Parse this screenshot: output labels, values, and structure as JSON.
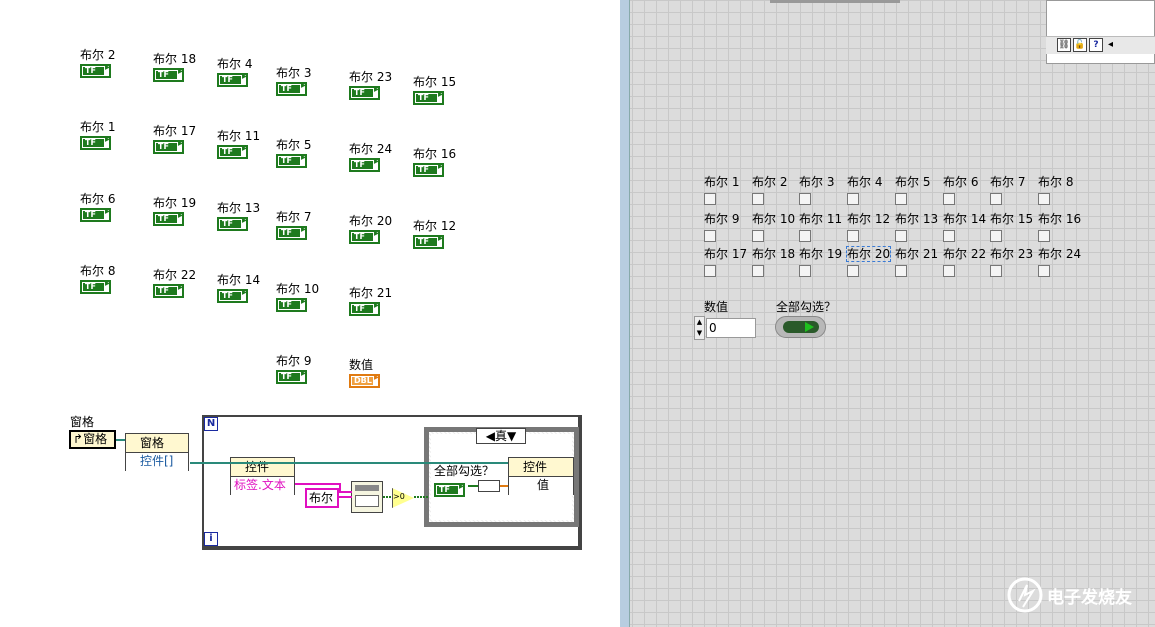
{
  "block_diagram": {
    "terminals": [
      {
        "label": "布尔 2"
      },
      {
        "label": "布尔 18"
      },
      {
        "label": "布尔 4"
      },
      {
        "label": "布尔 3"
      },
      {
        "label": "布尔 23"
      },
      {
        "label": "布尔 15"
      },
      {
        "label": "布尔 1"
      },
      {
        "label": "布尔 17"
      },
      {
        "label": "布尔 11"
      },
      {
        "label": "布尔 5"
      },
      {
        "label": "布尔 24"
      },
      {
        "label": "布尔 16"
      },
      {
        "label": "布尔 6"
      },
      {
        "label": "布尔 19"
      },
      {
        "label": "布尔 13"
      },
      {
        "label": "布尔 7"
      },
      {
        "label": "布尔 20"
      },
      {
        "label": "布尔 12"
      },
      {
        "label": "布尔 8"
      },
      {
        "label": "布尔 22"
      },
      {
        "label": "布尔 14"
      },
      {
        "label": "布尔 10"
      },
      {
        "label": "布尔 21"
      },
      {
        "label": "布尔 9"
      }
    ],
    "tf_badge": "TF",
    "numeric_terminal": {
      "label": "数值",
      "badge": "DBL"
    },
    "pane": {
      "label": "窗格",
      "ref_text": "窗格"
    },
    "property_node": {
      "class_text": "窗格",
      "property": "控件[]"
    },
    "for_loop": {
      "n_label": "N",
      "i_label": "i"
    },
    "inner_node": {
      "class_text": "控件",
      "property": "标签.文本"
    },
    "string_const": "布尔",
    "case": {
      "selector": "真"
    },
    "case_terminal_label": "全部勾选？",
    "case_badge": "TF",
    "case_prop_node": {
      "class_text": "控件",
      "property": "值"
    },
    "compare": ">0"
  },
  "front_panel": {
    "checkboxes": [
      "布尔 1",
      "布尔 2",
      "布尔 3",
      "布尔 4",
      "布尔 5",
      "布尔 6",
      "布尔 7",
      "布尔 8",
      "布尔 9",
      "布尔 10",
      "布尔 11",
      "布尔 12",
      "布尔 13",
      "布尔 14",
      "布尔 15",
      "布尔 16",
      "布尔 17",
      "布尔 18",
      "布尔 19",
      "布尔 20",
      "布尔 21",
      "布尔 22",
      "布尔 23",
      "布尔 24"
    ],
    "numeric": {
      "label": "数值",
      "value": "0"
    },
    "toggle": {
      "label": "全部勾选？"
    }
  },
  "context_help": {
    "icons": [
      "help-icon",
      "lock-icon",
      "question-icon"
    ]
  },
  "watermark": "电子发烧友",
  "colors": {
    "bool_green": "#1e7a1e",
    "dbl_orange": "#e07a10",
    "wire_pink": "#e010c0",
    "wire_teal": "#2a8a7a",
    "loop_blue": "#1a2aa0"
  }
}
